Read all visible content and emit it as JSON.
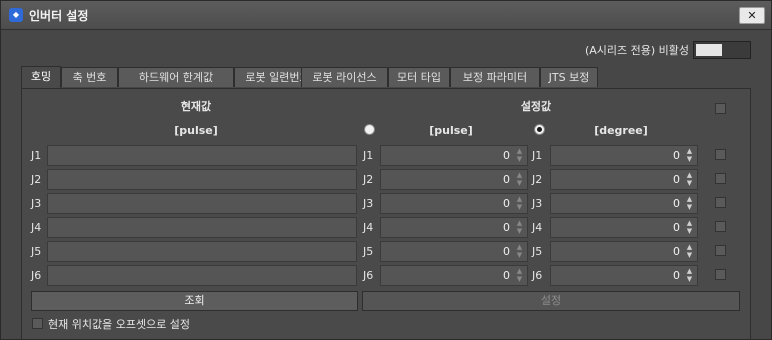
{
  "window": {
    "title": "인버터 설정",
    "close_label": "✕"
  },
  "series_toggle": {
    "label": "(A시리즈 전용) 비활성"
  },
  "tabs": [
    {
      "label": "호밍",
      "active": true
    },
    {
      "label": "축 번호"
    },
    {
      "label": "하드웨어 한계값"
    },
    {
      "label": "로봇 일련번호"
    },
    {
      "label": "로봇 라이선스"
    },
    {
      "label": "모터 타입"
    },
    {
      "label": "보정 파라미터"
    },
    {
      "label": "JTS 보정"
    }
  ],
  "homing": {
    "current_header": "현재값",
    "setting_header": "설정값",
    "current_unit": "[pulse]",
    "pulse_unit": "[pulse]",
    "degree_unit": "[degree]",
    "joints": [
      {
        "label": "J1",
        "current": "",
        "pulse": "0",
        "degree": "0"
      },
      {
        "label": "J2",
        "current": "",
        "pulse": "0",
        "degree": "0"
      },
      {
        "label": "J3",
        "current": "",
        "pulse": "0",
        "degree": "0"
      },
      {
        "label": "J4",
        "current": "",
        "pulse": "0",
        "degree": "0"
      },
      {
        "label": "J5",
        "current": "",
        "pulse": "0",
        "degree": "0"
      },
      {
        "label": "J6",
        "current": "",
        "pulse": "0",
        "degree": "0"
      }
    ],
    "query_button": "조회",
    "set_button": "설정",
    "offset_label": "현재 위치값을 오프셋으로 설정"
  }
}
